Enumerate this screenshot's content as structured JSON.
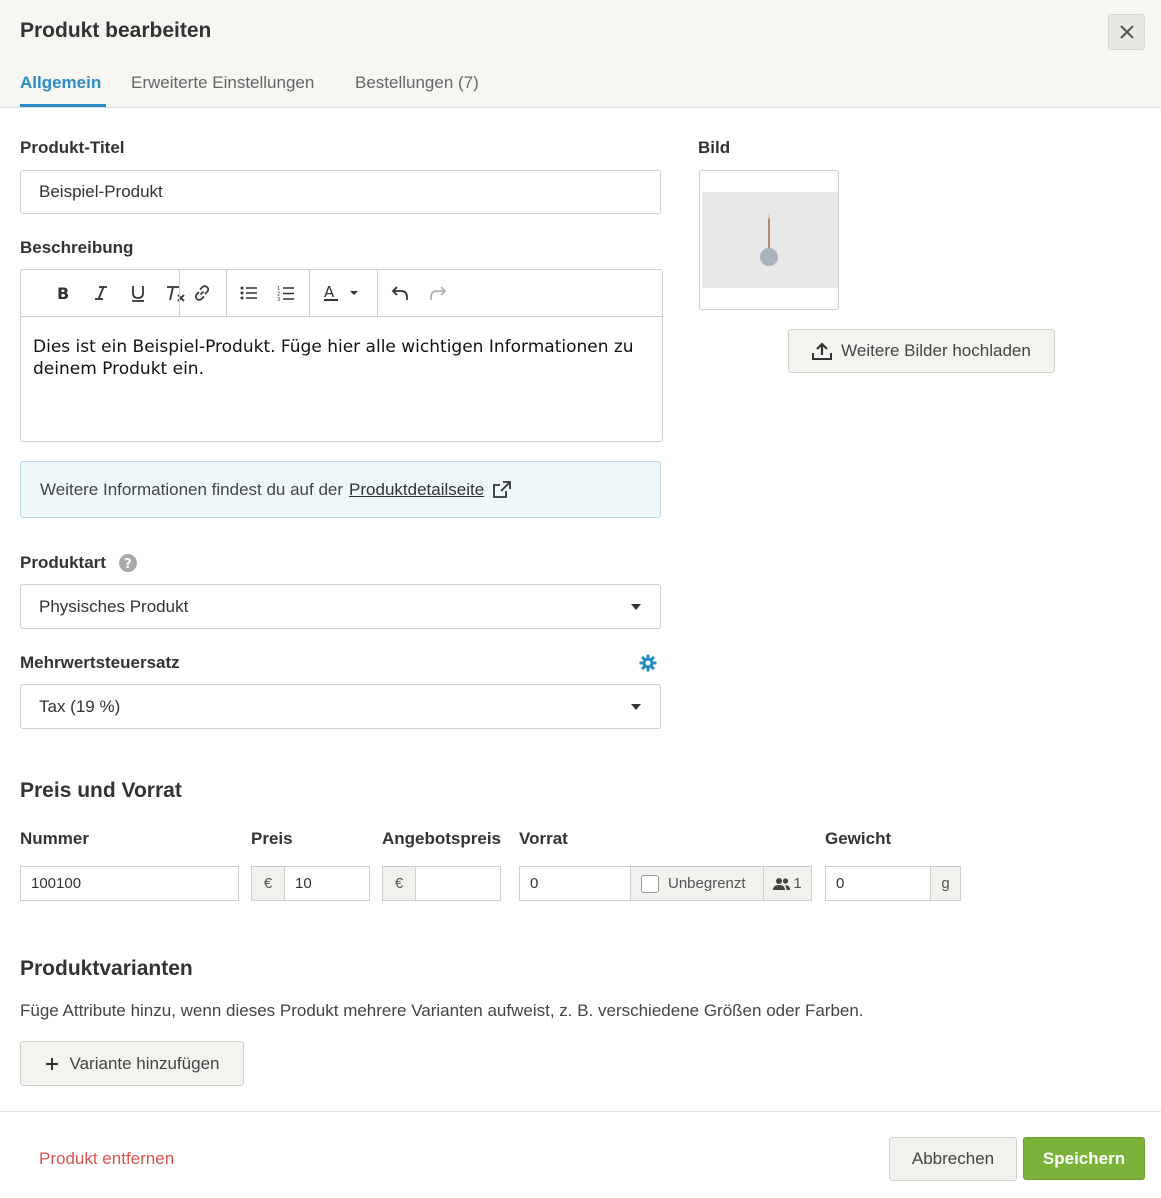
{
  "modal": {
    "title": "Produkt bearbeiten"
  },
  "tabs": [
    {
      "label": "Allgemein",
      "active": true
    },
    {
      "label": "Erweiterte Einstellungen",
      "active": false
    },
    {
      "label": "Bestellungen (7)",
      "active": false
    }
  ],
  "form": {
    "title_label": "Produkt-Titel",
    "title_value": "Beispiel-Produkt",
    "description_label": "Beschreibung",
    "description_text": "Dies ist ein Beispiel-Produkt. Füge hier alle wichtigen Informationen zu deinem Produkt ein.",
    "toolbar_icons": [
      "bold-icon",
      "italic-icon",
      "underline-icon",
      "clear-format-icon",
      "link-icon",
      "bullet-list-icon",
      "numbered-list-icon",
      "text-color-icon",
      "undo-icon",
      "redo-icon"
    ],
    "info_text": "Weitere Informationen findest du auf der",
    "info_link": "Produktdetailseite",
    "product_type_label": "Produktart",
    "product_type_value": "Physisches Produkt",
    "vat_label": "Mehrwertsteuersatz",
    "vat_value": "Tax (19 %)"
  },
  "image": {
    "label": "Bild",
    "upload_button": "Weitere Bilder hochladen"
  },
  "pricing": {
    "section_title": "Preis und Vorrat",
    "number_label": "Nummer",
    "number_value": "100100",
    "price_label": "Preis",
    "currency": "€",
    "price_value": "10",
    "sale_price_label": "Angebotspreis",
    "sale_price_value": "",
    "stock_label": "Vorrat",
    "stock_value": "0",
    "unlimited_label": "Unbegrenzt",
    "unlimited_checked": false,
    "per_customer_value": "1",
    "weight_label": "Gewicht",
    "weight_value": "0",
    "weight_unit": "g"
  },
  "variants": {
    "section_title": "Produktvarianten",
    "description": "Füge Attribute hinzu, wenn dieses Produkt mehrere Varianten aufweist, z. B. verschiedene Größen oder Farben.",
    "add_button": "Variante hinzufügen"
  },
  "footer": {
    "remove_link": "Produkt entfernen",
    "cancel_button": "Abbrechen",
    "save_button": "Speichern"
  },
  "colors": {
    "accent": "#2b8cc4",
    "primary_button": "#7bb33a",
    "danger": "#d9534f"
  }
}
